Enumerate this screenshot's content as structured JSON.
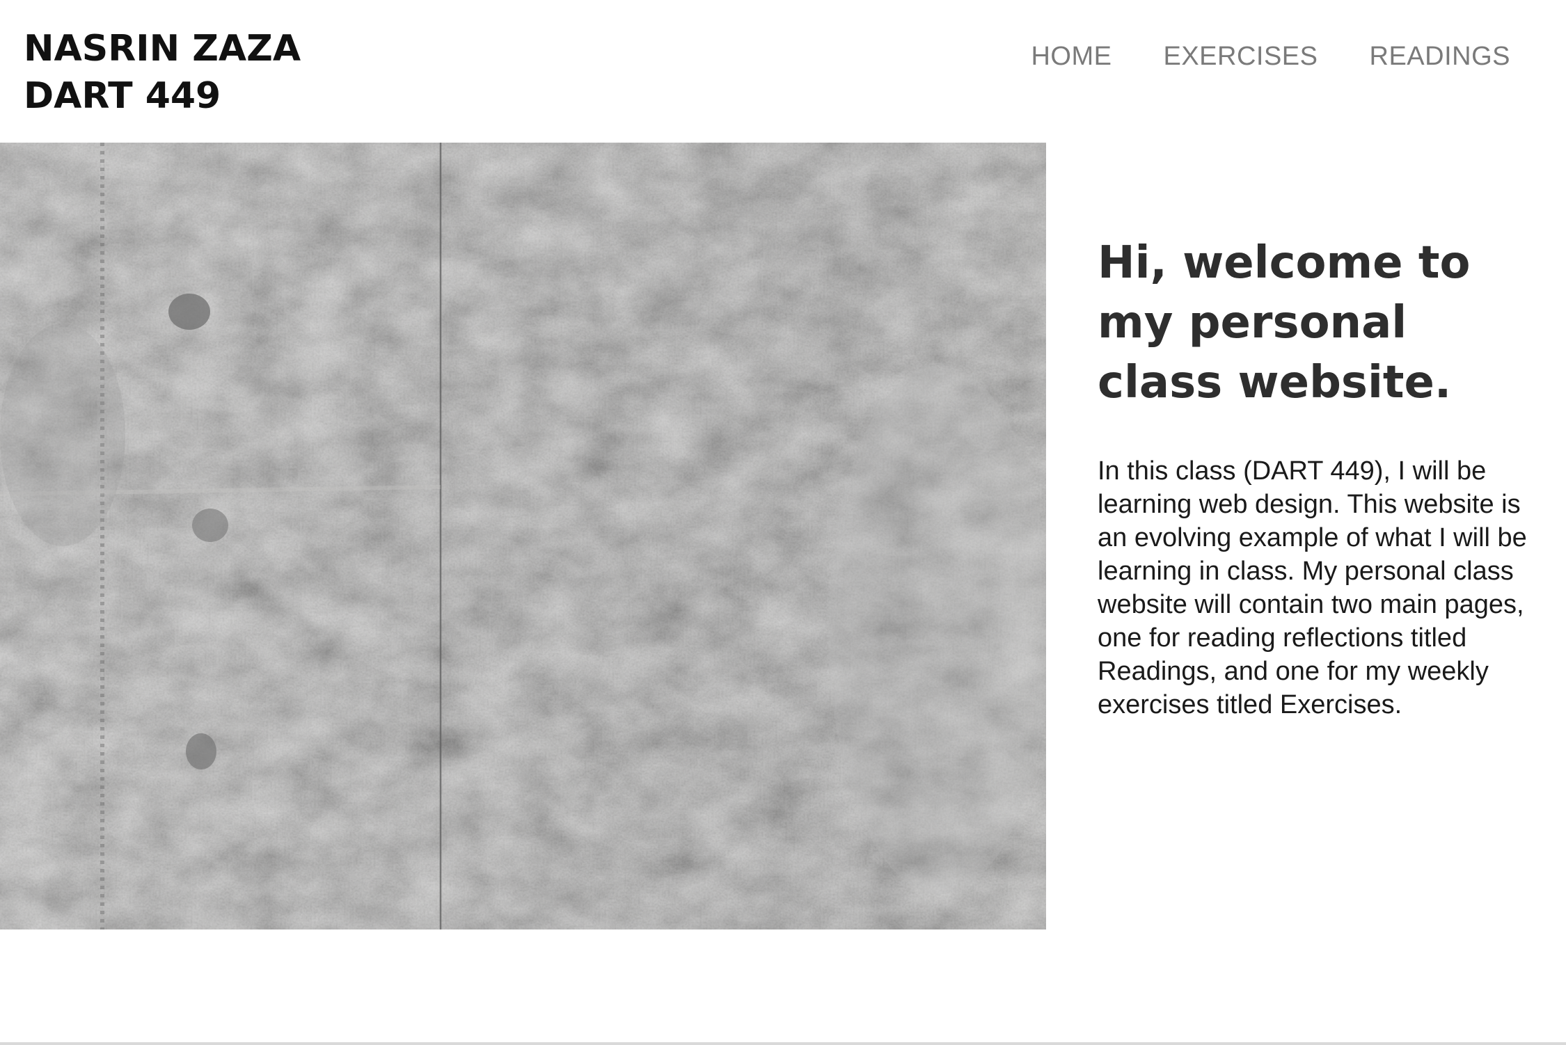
{
  "header": {
    "brand_line1": "NASRIN ZAZA",
    "brand_line2": "DART 449"
  },
  "nav": {
    "items": [
      {
        "label": "HOME"
      },
      {
        "label": "EXERCISES"
      },
      {
        "label": "READINGS"
      }
    ]
  },
  "hero": {
    "image": "concrete-wall-texture"
  },
  "intro": {
    "heading": "Hi, welcome to my personal class website.",
    "body": "In this class (DART 449), I will be learning web design. This website is an evolving example of what I will be learning in class. My personal class website will contain two main pages, one for reading reflections titled Readings, and one for my weekly exercises titled Exercises."
  },
  "colors": {
    "brand_text": "#111111",
    "nav_text": "#7a7a7a",
    "heading_text": "#2e2e2e",
    "body_text": "#1a1a1a",
    "concrete": "#a9a8a7"
  }
}
